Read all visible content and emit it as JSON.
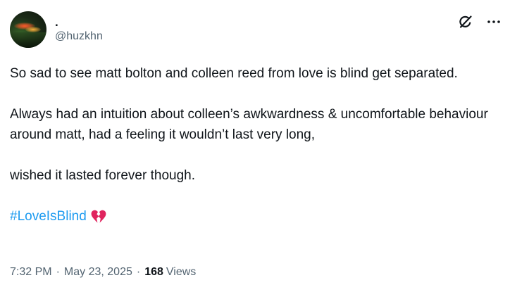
{
  "tweet": {
    "display_name": ".",
    "handle": "@huzkhn",
    "paragraphs": [
      "So sad to see matt bolton and colleen reed from love is blind get separated.",
      "Always had an intuition about colleen’s awkwardness & uncomfortable behaviour around matt, had a feeling it wouldn’t last very long,",
      "wished it lasted forever though."
    ],
    "hashtag": "#LoveIsBlind",
    "emoji": "broken-heart",
    "time": "7:32 PM",
    "separator": "·",
    "date": "May 23, 2025",
    "views_count": "168",
    "views_label": "Views"
  },
  "icons": {
    "grok": "grok-icon",
    "more": "more-icon"
  },
  "colors": {
    "text": "#0f1419",
    "secondary": "#536471",
    "link": "#1d9bf0",
    "heart": "#e0245e"
  }
}
